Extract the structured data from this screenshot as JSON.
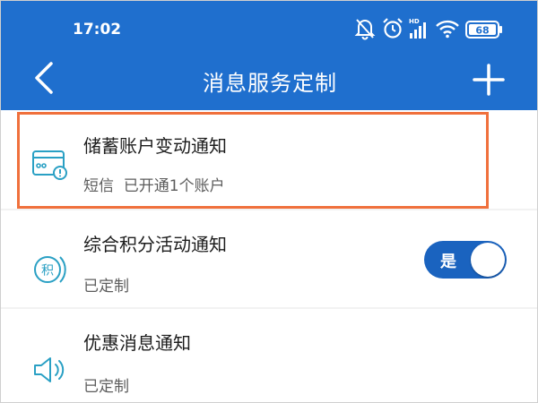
{
  "status_bar": {
    "time": "17:02",
    "hd_label": "HD",
    "battery": "68",
    "icons": [
      "mute-bell-icon",
      "alarm-icon",
      "signal-icon",
      "wifi-icon",
      "battery-icon"
    ]
  },
  "nav": {
    "title": "消息服务定制",
    "back_icon": "chevron-left-icon",
    "add_icon": "plus-icon"
  },
  "items": [
    {
      "title": "储蓄账户变动通知",
      "subtitle": "短信  已开通1个账户",
      "icon": "card-alert-icon"
    },
    {
      "title": "综合积分活动通知",
      "subtitle": "已定制",
      "icon": "points-icon",
      "icon_char": "积",
      "toggle_label": "是",
      "toggle_on": true
    },
    {
      "title": "优惠消息通知",
      "subtitle": "已定制",
      "icon": "speaker-icon"
    }
  ],
  "colors": {
    "header": "#1f6fce",
    "highlight": "#f0703c",
    "toggle_on": "#1a63bf",
    "icon_accent": "#2aa0c4"
  }
}
